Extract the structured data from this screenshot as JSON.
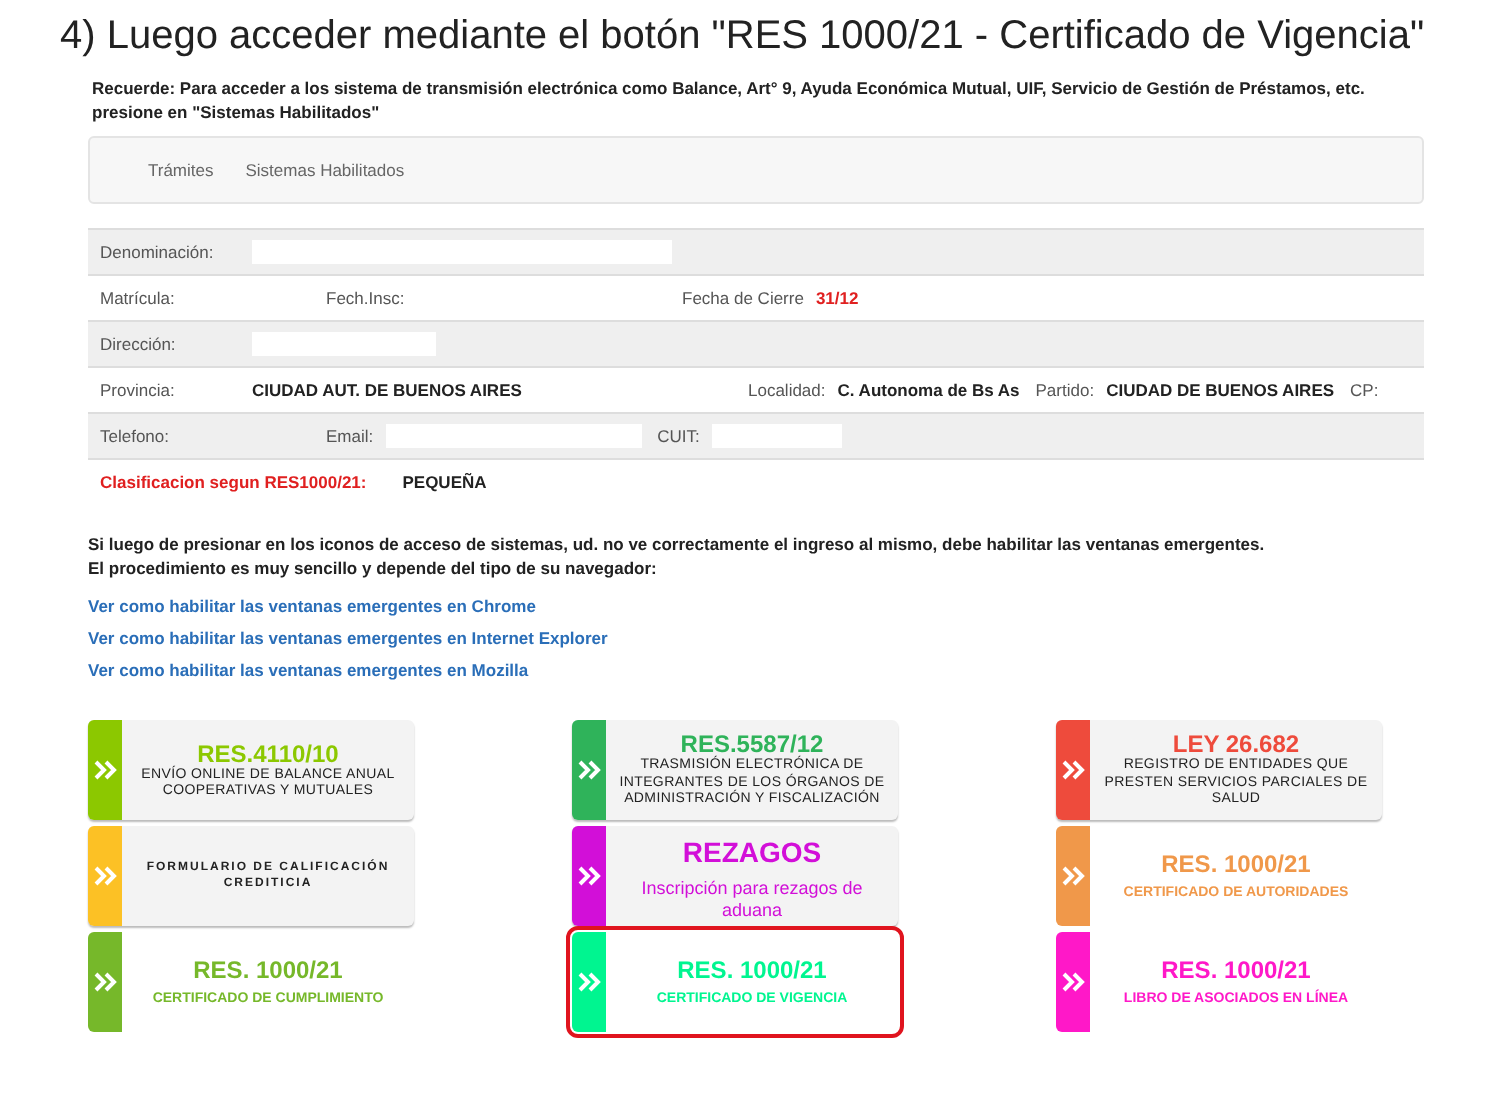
{
  "heading": "4) Luego acceder mediante el botón \"RES 1000/21 - Certificado de Vigencia\"",
  "reminder": "Recuerde: Para acceder a los sistema de transmisión electrónica como Balance, Art° 9, Ayuda Económica Mutual, UIF, Servicio de Gestión de Préstamos, etc. presione en \"Sistemas Habilitados\"",
  "tabs": [
    {
      "label": "Trámites"
    },
    {
      "label": "Sistemas Habilitados"
    }
  ],
  "form_rows": [
    {
      "cells": [
        {
          "kind": "blank",
          "label": "Denominación:"
        }
      ]
    },
    {
      "cells": [
        {
          "kind": "label",
          "label": "Matrícula:"
        },
        {
          "kind": "label",
          "label": "Fech.Insc:"
        },
        {
          "kind": "alert",
          "label": "Fecha de Cierre",
          "value": "31/12"
        }
      ]
    },
    {
      "cells": [
        {
          "kind": "blank",
          "label": "Dirección:"
        }
      ]
    },
    {
      "cells": [
        {
          "kind": "bold",
          "label": "Provincia:",
          "value": "CIUDAD AUT. DE BUENOS AIRES"
        },
        {
          "kind": "bold",
          "label": "Localidad:",
          "value": "C. Autonoma de Bs As"
        },
        {
          "kind": "bold",
          "label": "Partido:",
          "value": "CIUDAD DE BUENOS AIRES"
        },
        {
          "kind": "label",
          "label": "CP:"
        }
      ]
    },
    {
      "cells": [
        {
          "kind": "label",
          "label": "Telefono:"
        },
        {
          "kind": "blank",
          "label": "Email:"
        },
        {
          "kind": "blank",
          "label": "CUIT:"
        }
      ]
    }
  ],
  "classification": {
    "label": "Clasificacion segun RES1000/21:",
    "value": "PEQUEÑA"
  },
  "notice": [
    "Si luego de presionar en los iconos de acceso de sistemas, ud. no ve correctamente el ingreso al mismo, debe habilitar las ventanas emergentes.",
    "El procedimiento es muy sencillo y depende del tipo de su navegador:"
  ],
  "links": [
    "Ver como habilitar las ventanas emergentes en Chrome",
    "Ver como habilitar las ventanas emergentes en Internet Explorer",
    "Ver como habilitar las ventanas emergentes en Mozilla"
  ],
  "tiles": [
    {
      "kind": "card",
      "color": "#8cc800",
      "title": "RES.4110/10",
      "text": "ENVÍO ONLINE DE BALANCE ANUAL COOPERATIVAS Y MUTUALES",
      "selected": false
    },
    {
      "kind": "card",
      "color": "#2fb35a",
      "title": "RES.5587/12",
      "text": "TRASMISIÓN ELECTRÓNICA DE INTEGRANTES DE LOS ÓRGANOS DE ADMINISTRACIÓN Y FISCALIZACIÓN",
      "selected": false
    },
    {
      "kind": "card",
      "color": "#ee4b3c",
      "title": "LEY 26.682",
      "text": "REGISTRO DE ENTIDADES QUE PRESTEN SERVICIOS PARCIALES DE SALUD",
      "selected": false
    },
    {
      "kind": "card",
      "color": "#fcc125",
      "text": "FORMULARIO DE CALIFICACIÓN CREDITICIA",
      "selected": false
    },
    {
      "kind": "accent-card",
      "color": "#d20fd8",
      "title": "REZAGOS",
      "text": "Inscripción para rezagos de aduana",
      "selected": false
    },
    {
      "kind": "plain",
      "color": "#f0984a",
      "title": "RES. 1000/21",
      "text": "CERTIFICADO DE AUTORIDADES",
      "selected": false
    },
    {
      "kind": "plain",
      "color": "#76b82a",
      "title": "RES. 1000/21",
      "text": "CERTIFICADO DE CUMPLIMIENTO",
      "selected": false
    },
    {
      "kind": "plain",
      "color": "#00f590",
      "title": "RES. 1000/21",
      "text": "CERTIFICADO DE VIGENCIA",
      "selected": true
    },
    {
      "kind": "plain",
      "color": "#ff18c8",
      "title": "RES. 1000/21",
      "text": "LIBRO DE ASOCIADOS EN LÍNEA",
      "selected": false
    }
  ]
}
